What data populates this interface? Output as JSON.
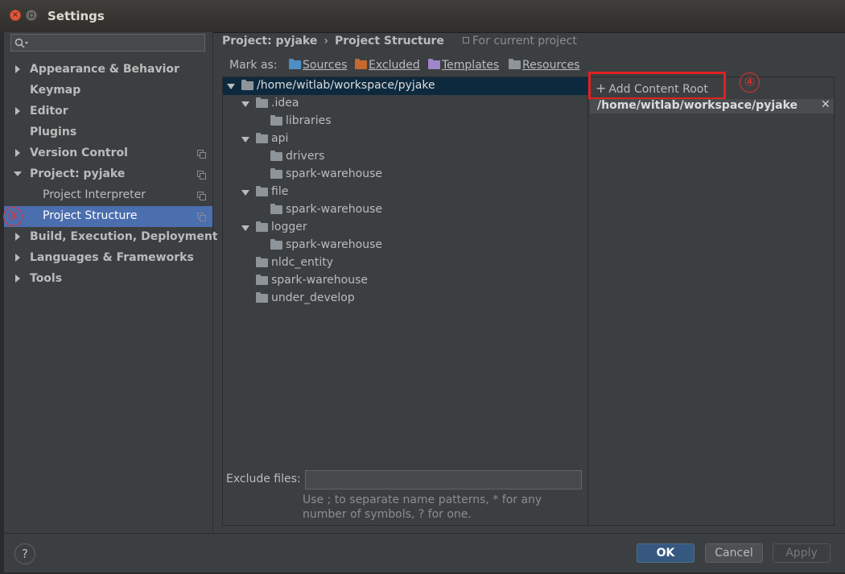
{
  "window": {
    "title": "Settings"
  },
  "search": {
    "placeholder": ""
  },
  "sidebar": {
    "items": [
      {
        "label": "Appearance & Behavior",
        "arrow": "right",
        "copy": false
      },
      {
        "label": "Keymap",
        "arrow": "none",
        "copy": false
      },
      {
        "label": "Editor",
        "arrow": "right",
        "copy": false
      },
      {
        "label": "Plugins",
        "arrow": "none",
        "copy": false
      },
      {
        "label": "Version Control",
        "arrow": "right",
        "copy": true
      },
      {
        "label": "Project: pyjake",
        "arrow": "down",
        "copy": true
      },
      {
        "label": "Project Interpreter",
        "arrow": "none",
        "copy": true,
        "sub": true
      },
      {
        "label": "Project Structure",
        "arrow": "none",
        "copy": true,
        "sub": true,
        "selected": true
      },
      {
        "label": "Build, Execution, Deployment",
        "arrow": "right",
        "copy": false
      },
      {
        "label": "Languages & Frameworks",
        "arrow": "right",
        "copy": false
      },
      {
        "label": "Tools",
        "arrow": "right",
        "copy": false
      }
    ]
  },
  "annotations": {
    "left_marker": "③",
    "right_marker": "④"
  },
  "breadcrumb": {
    "project": "Project: pyjake",
    "separator": "›",
    "page": "Project Structure",
    "scope": "For current project"
  },
  "mark_as": {
    "label": "Mark as:",
    "sources": "Sources",
    "excluded": "Excluded",
    "templates": "Templates",
    "resources": "Resources"
  },
  "tree": {
    "rows": [
      {
        "label": "/home/witlab/workspace/pyjake",
        "depth": 0,
        "expanded": true,
        "selected": true
      },
      {
        "label": ".idea",
        "depth": 1,
        "expanded": true
      },
      {
        "label": "libraries",
        "depth": 2,
        "expanded": false
      },
      {
        "label": "api",
        "depth": 1,
        "expanded": true
      },
      {
        "label": "drivers",
        "depth": 2,
        "expanded": false
      },
      {
        "label": "spark-warehouse",
        "depth": 2,
        "expanded": false
      },
      {
        "label": "file",
        "depth": 1,
        "expanded": true
      },
      {
        "label": "spark-warehouse",
        "depth": 2,
        "expanded": false
      },
      {
        "label": "logger",
        "depth": 1,
        "expanded": true
      },
      {
        "label": "spark-warehouse",
        "depth": 2,
        "expanded": false
      },
      {
        "label": "nldc_entity",
        "depth": 1,
        "expanded": false
      },
      {
        "label": "spark-warehouse",
        "depth": 1,
        "expanded": false
      },
      {
        "label": "under_develop",
        "depth": 1,
        "expanded": false
      }
    ]
  },
  "exclude": {
    "label": "Exclude files:",
    "value": "",
    "hint": "Use ; to separate name patterns, * for any number of symbols, ? for one."
  },
  "content_roots": {
    "add_label": "Add Content Root",
    "roots": [
      "/home/witlab/workspace/pyjake"
    ]
  },
  "footer": {
    "help": "?",
    "ok": "OK",
    "cancel": "Cancel",
    "apply": "Apply"
  },
  "colors": {
    "selection": "#4b6eaf",
    "tree_selection": "#0d293e",
    "annotation": "#e02020"
  }
}
